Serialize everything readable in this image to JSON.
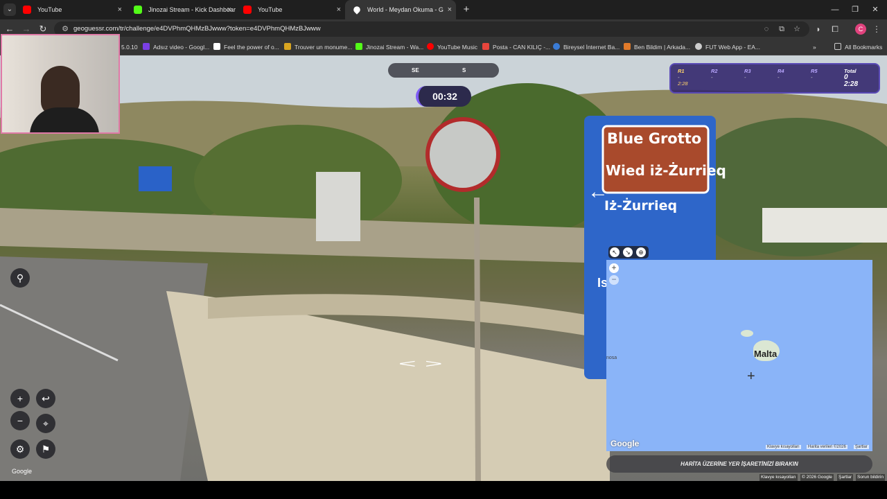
{
  "browser": {
    "tabs": [
      {
        "label": "YouTube",
        "icon": "youtube-icon"
      },
      {
        "label": "Jinozai Stream - Kick Dashboard",
        "icon": "kick-icon"
      },
      {
        "label": "YouTube",
        "icon": "youtube-icon"
      },
      {
        "label": "World - Meydan Okuma - G",
        "icon": "geoguessr-pin-icon",
        "active": true
      }
    ],
    "new_tab": "+",
    "tab_close": "×",
    "url": "geoguessr.com/tr/challenge/e4DVPhmQHMzBJwww?token=e4DVPhmQHMzBJwww",
    "bookmarks": [
      {
        "label": "5.0.10"
      },
      {
        "label": "Adsız video - Googl..."
      },
      {
        "label": "Feel the power of o..."
      },
      {
        "label": "Trouver un monume..."
      },
      {
        "label": "Jinozai Stream - Wa..."
      },
      {
        "label": "YouTube Music"
      },
      {
        "label": "Posta - CAN KILIÇ -..."
      },
      {
        "label": "Bireysel İnternet Ba..."
      },
      {
        "label": "Ben Bildim | Arkada..."
      },
      {
        "label": "FUT Web App - EA..."
      }
    ],
    "all_bookmarks": "All Bookmarks",
    "more_bookmarks": "»",
    "profile_initial": "C"
  },
  "game": {
    "compass": {
      "left": "SE",
      "right": "S"
    },
    "timer": "00:32",
    "rounds": [
      {
        "label": "R1",
        "value": "-",
        "time": "2:28",
        "current": true
      },
      {
        "label": "R2",
        "value": "-"
      },
      {
        "label": "R3",
        "value": "-"
      },
      {
        "label": "R4",
        "value": "-"
      },
      {
        "label": "R5",
        "value": "-"
      }
    ],
    "total": {
      "label": "Total",
      "score": "0",
      "time": "2:28"
    },
    "google_label": "Google"
  },
  "map": {
    "country_label": "Malta",
    "edge_label": "nosa",
    "google_logo": "Google",
    "attr_shortcuts": "Klavye kısayolları",
    "attr_data": "Harita verileri ©2026",
    "attr_terms": "Şartlar",
    "zoom_in": "+",
    "zoom_out": "−",
    "guess_button": "HARİTA ÜZERİNE YER İŞARETİNİZİ BIRAKIN"
  },
  "footer": {
    "shortcuts": "Klavye kısayolları",
    "copyright": "© 2026 Google",
    "terms": "Şartlar",
    "report": "Sorun bildirin"
  },
  "scene_sign": {
    "line1": "Blue Grotto",
    "line2": "Wied iż-Żurrieq",
    "line3": "Iż-Żurrieq",
    "small_sign": "Is"
  },
  "colors": {
    "accent": "#7e5cf4",
    "hud_bg": "#34286e",
    "map_water": "#8ab4f8",
    "webcam_border": "#e07aa7"
  }
}
